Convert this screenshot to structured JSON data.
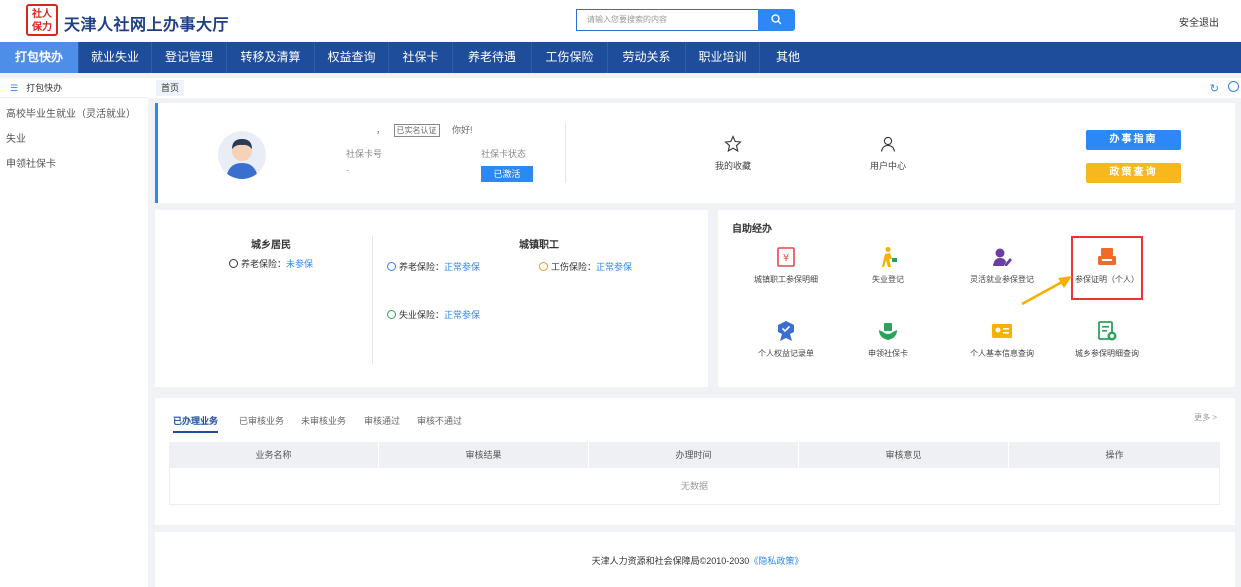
{
  "header": {
    "logo_text": "社人保力",
    "title": "天津人社网上办事大厅",
    "search_placeholder": "请输入您要搜索的内容",
    "logout": "安全退出"
  },
  "nav": {
    "items": [
      "打包快办",
      "就业失业",
      "登记管理",
      "转移及清算",
      "权益查询",
      "社保卡",
      "养老待遇",
      "工伤保险",
      "劳动关系",
      "职业培训",
      "其他"
    ],
    "active_index": 0
  },
  "sidebar": {
    "heading": "打包快办",
    "items": [
      "高校毕业生就业（灵活就业）",
      "失业",
      "申领社保卡"
    ]
  },
  "tabs": {
    "home": "首页"
  },
  "profile": {
    "name_dot": "，",
    "verified": "已实名认证",
    "greeting": "你好!",
    "card_no_label": "社保卡号",
    "card_no_value": "-",
    "card_status_label": "社保卡状态",
    "card_status_value": "已激活",
    "favorites": "我的收藏",
    "user_center": "用户中心",
    "guide_button": "办事指南",
    "policy_button": "政策查询"
  },
  "insurance": {
    "urban_rural_title": "城乡居民",
    "urban_worker_title": "城镇职工",
    "urban_rural_items": [
      {
        "label": "养老保险：",
        "status": "未参保"
      }
    ],
    "worker_items": [
      {
        "label": "养老保险：",
        "status": "正常参保",
        "color": "#2c88f5"
      },
      {
        "label": "工伤保险：",
        "status": "正常参保",
        "color": "#e89a1a"
      },
      {
        "label": "失业保险：",
        "status": "正常参保",
        "color": "#2aa35a"
      }
    ]
  },
  "self_service": {
    "title": "自助经办",
    "items": [
      {
        "label": "城镇职工参保明细",
        "icon": "receipt-icon"
      },
      {
        "label": "失业登记",
        "icon": "walking-person-icon"
      },
      {
        "label": "灵活就业参保登记",
        "icon": "user-edit-icon"
      },
      {
        "label": "参保证明（个人）",
        "icon": "printer-icon"
      },
      {
        "label": "个人权益记录单",
        "icon": "badge-icon"
      },
      {
        "label": "申领社保卡",
        "icon": "hand-card-icon"
      },
      {
        "label": "个人基本信息查询",
        "icon": "id-card-icon"
      },
      {
        "label": "城乡参保明细查询",
        "icon": "ledger-search-icon"
      }
    ]
  },
  "records": {
    "tabs": [
      "已办理业务",
      "已审核业务",
      "未审核业务",
      "审核通过",
      "审核不通过"
    ],
    "more": "更多 >",
    "columns": [
      "业务名称",
      "审核结果",
      "办理时间",
      "审核意见",
      "操作"
    ],
    "empty": "无数据"
  },
  "footer": {
    "text": "天津人力资源和社会保障局©2010-2030",
    "privacy": "《隐私政策》"
  }
}
